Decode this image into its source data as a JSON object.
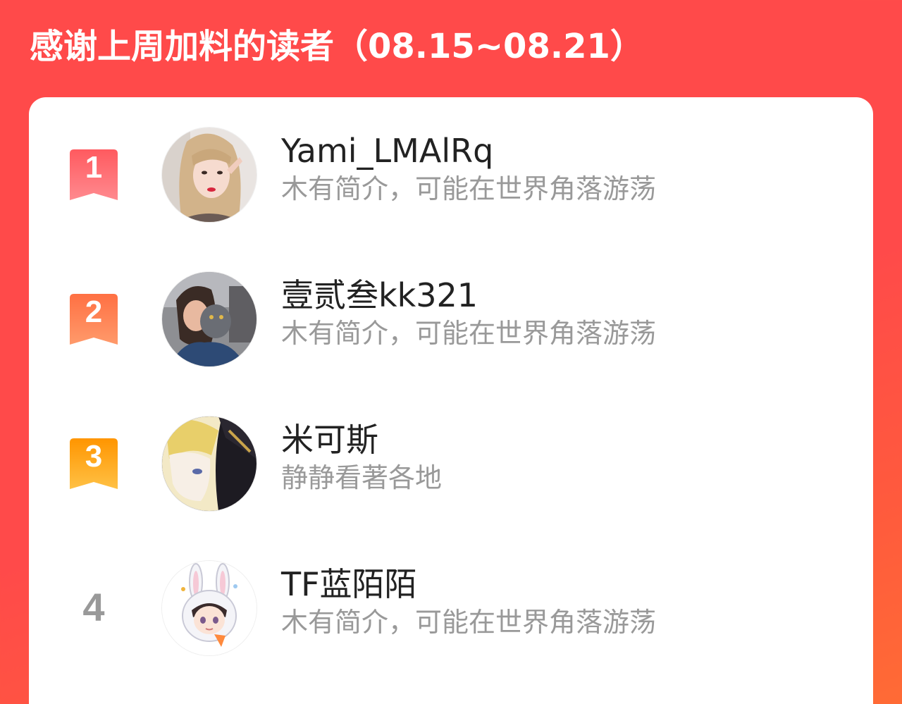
{
  "header": {
    "title": "感谢上周加料的读者（08.15~08.21）"
  },
  "colors": {
    "background": "#ff4a4a",
    "rank1": "#ff5c63",
    "rank2": "#ff7a4a",
    "rank3": "#ff9a1f",
    "rank_plain": "#999999"
  },
  "readers": [
    {
      "rank": "1",
      "name": "Yami_LMAlRq",
      "bio": "木有简介，可能在世界角落游荡",
      "avatar": "avatar-photo-girl"
    },
    {
      "rank": "2",
      "name": "壹贰叁kk321",
      "bio": "木有简介，可能在世界角落游荡",
      "avatar": "avatar-photo-girl-with-cat"
    },
    {
      "rank": "3",
      "name": "米可斯",
      "bio": "静静看著各地",
      "avatar": "avatar-anime-blonde"
    },
    {
      "rank": "4",
      "name": "TF蓝陌陌",
      "bio": "木有简介，可能在世界角落游荡",
      "avatar": "avatar-bunny-hood-cartoon"
    }
  ]
}
